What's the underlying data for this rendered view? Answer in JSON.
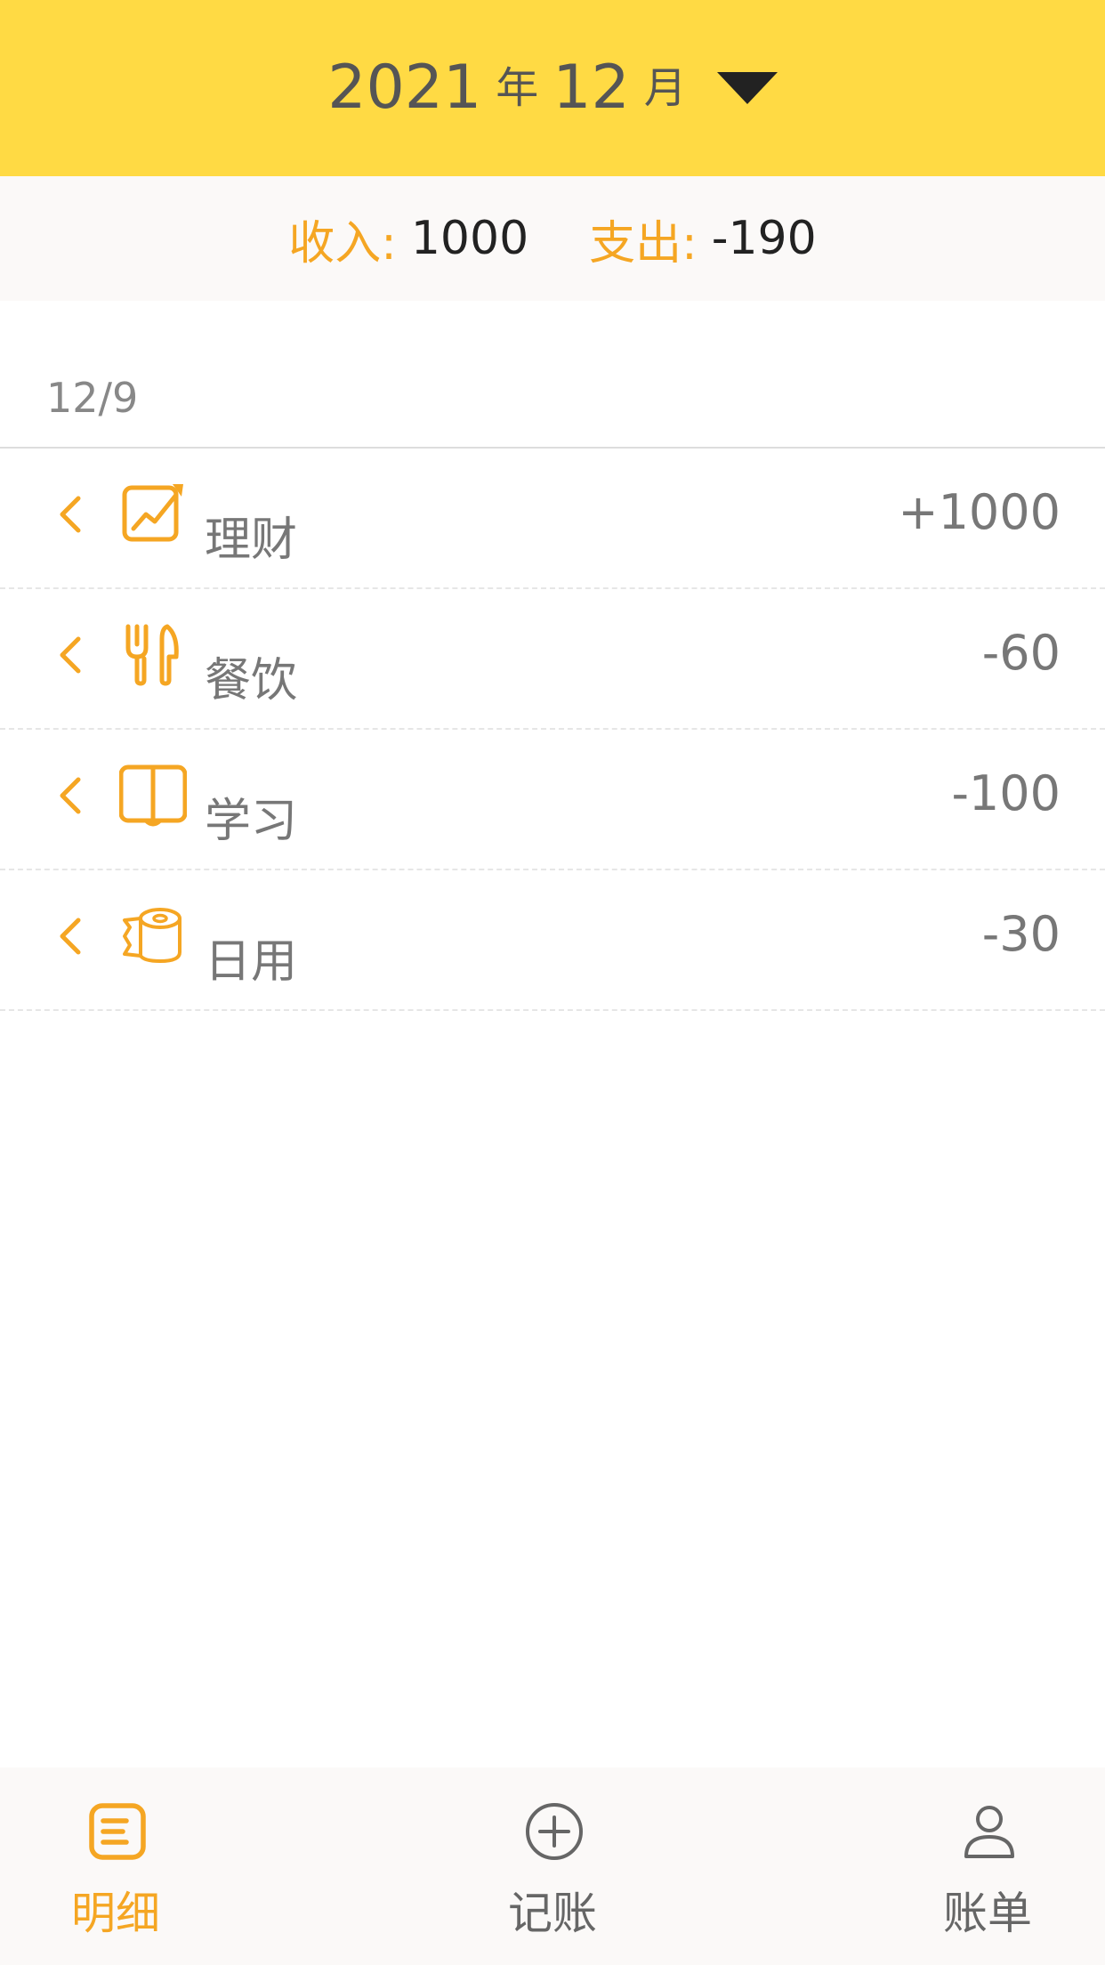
{
  "header": {
    "year": "2021",
    "year_unit": "年",
    "month": "12",
    "month_unit": "月"
  },
  "summary": {
    "income_label": "收入:",
    "income_value": "1000",
    "expense_label": "支出:",
    "expense_value": "-190"
  },
  "date_group": "12/9",
  "records": [
    {
      "icon": "chart-trend-icon",
      "label": "理财",
      "amount": "+1000"
    },
    {
      "icon": "fork-knife-icon",
      "label": "餐饮",
      "amount": "-60"
    },
    {
      "icon": "book-icon",
      "label": "学习",
      "amount": "-100"
    },
    {
      "icon": "toilet-paper-icon",
      "label": "日用",
      "amount": "-30"
    }
  ],
  "nav": [
    {
      "icon": "list-icon",
      "label": "明细",
      "active": true
    },
    {
      "icon": "add-circle-icon",
      "label": "记账",
      "active": false
    },
    {
      "icon": "user-icon",
      "label": "账单",
      "active": false
    }
  ],
  "colors": {
    "header_bg": "#FFDA44",
    "accent": "#F5A623",
    "text_gray": "#777777"
  }
}
